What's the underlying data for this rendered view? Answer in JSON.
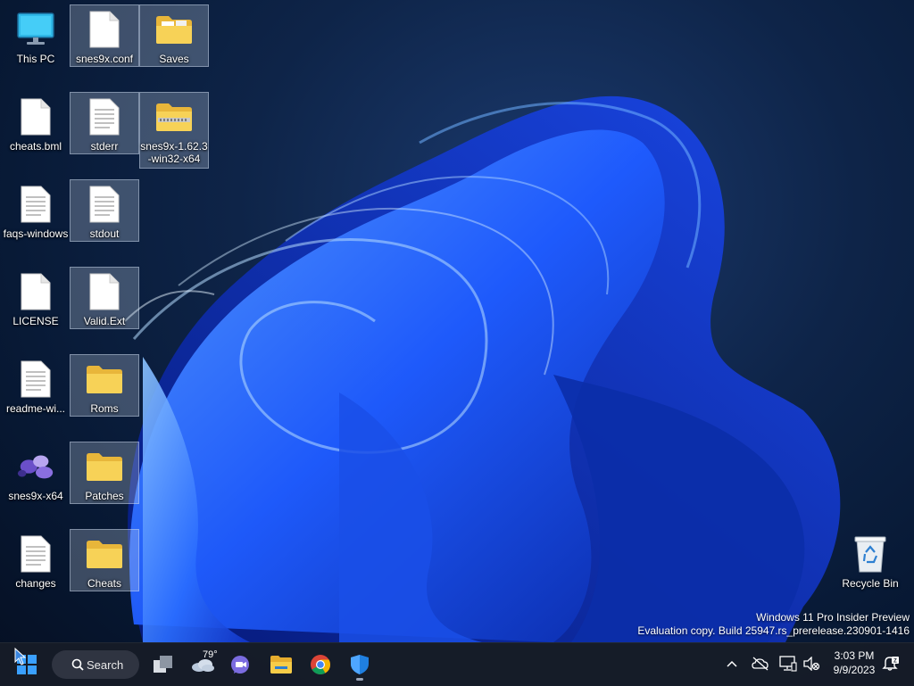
{
  "desktop": {
    "icons": [
      {
        "label": "This PC"
      },
      {
        "label": "snes9x.conf"
      },
      {
        "label": "Saves"
      },
      {
        "label": "cheats.bml"
      },
      {
        "label": "stderr"
      },
      {
        "label": "snes9x-1.62.3-win32-x64"
      },
      {
        "label": "faqs-windows"
      },
      {
        "label": "stdout"
      },
      {
        "label": "LICENSE"
      },
      {
        "label": "Valid.Ext"
      },
      {
        "label": "readme-wi..."
      },
      {
        "label": "Roms"
      },
      {
        "label": "snes9x-x64"
      },
      {
        "label": "Patches"
      },
      {
        "label": "changes"
      },
      {
        "label": "Cheats"
      },
      {
        "label": "Recycle Bin"
      }
    ]
  },
  "watermark": {
    "line1": "Windows 11 Pro Insider Preview",
    "line2": "Evaluation copy. Build 25947.rs_prerelease.230901-1416"
  },
  "taskbar": {
    "search_label": "Search",
    "weather_temp": "79°",
    "clock_time": "3:03 PM",
    "clock_date": "9/9/2023",
    "icons": [
      "start-icon",
      "search-icon",
      "task-view-icon",
      "weather-icon",
      "teams-chat-icon",
      "file-explorer-icon",
      "chrome-icon",
      "defender-icon"
    ],
    "tray_icons": [
      "chevron-up-icon",
      "onedrive-offline-icon",
      "network-icon",
      "volume-muted-icon",
      "notification-icon"
    ]
  },
  "colors": {
    "folder": "#f3c74f",
    "taskbar": "#161c28",
    "wallpaper_blue": "#1f5cff"
  }
}
